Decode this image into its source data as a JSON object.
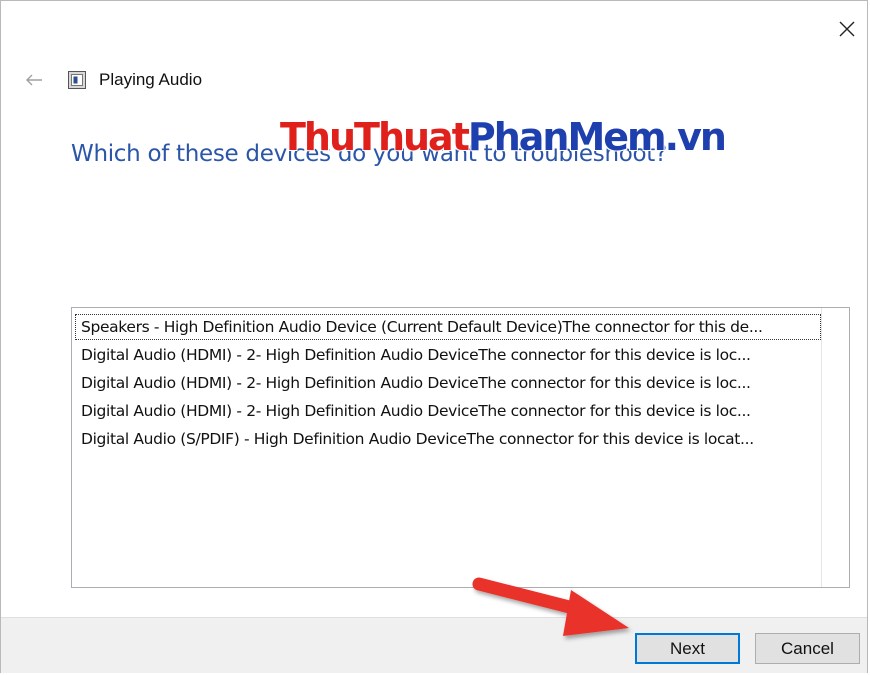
{
  "window": {
    "title": "Playing Audio",
    "back_icon": "back-arrow-icon",
    "close_icon": "close-icon",
    "title_icon": "troubleshooter-icon"
  },
  "watermark": {
    "part1": "ThuThuat",
    "part2": "PhanMem",
    "part3": ".vn"
  },
  "main": {
    "question": "Which of these devices do you want to troubleshoot?",
    "devices": [
      "Speakers - High Definition Audio Device (Current Default Device)The connector for this de...",
      "Digital Audio (HDMI) - 2- High Definition Audio DeviceThe connector for this device is loc...",
      "Digital Audio (HDMI) - 2- High Definition Audio DeviceThe connector for this device is loc...",
      "Digital Audio (HDMI) - 2- High Definition Audio DeviceThe connector for this device is loc...",
      "Digital Audio (S/PDIF) - High Definition Audio DeviceThe connector for this device is locat..."
    ]
  },
  "footer": {
    "next_label": "Next",
    "cancel_label": "Cancel"
  },
  "colors": {
    "question": "#2b55a8",
    "accent": "#0078d7",
    "annotation_arrow": "#e8302a"
  }
}
